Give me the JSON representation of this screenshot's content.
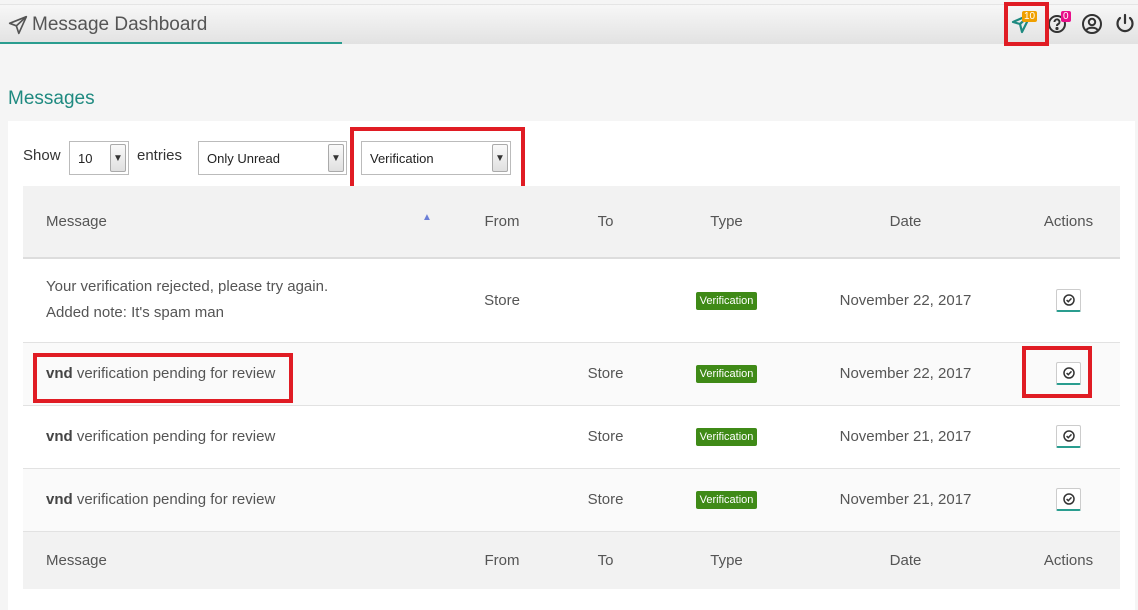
{
  "header": {
    "title": "Message Dashboard",
    "notifications_count": "10",
    "help_count": "0"
  },
  "section_title": "Messages",
  "controls": {
    "show_label": "Show",
    "entries_value": "10",
    "entries_label": "entries",
    "filter_read": "Only Unread",
    "filter_type": "Verification"
  },
  "table": {
    "columns": [
      "Message",
      "From",
      "To",
      "Type",
      "Date",
      "Actions"
    ],
    "rows": [
      {
        "line1": "Your verification rejected, please try again.",
        "line2": "Added note: It's spam man",
        "bold": "",
        "from": "Store",
        "to": "",
        "type": "Verification",
        "date": "November 22, 2017"
      },
      {
        "bold": "vnd",
        "line1": " verification pending for review",
        "line2": "",
        "from": "",
        "to": "Store",
        "type": "Verification",
        "date": "November 22, 2017"
      },
      {
        "bold": "vnd",
        "line1": " verification pending for review",
        "line2": "",
        "from": "",
        "to": "Store",
        "type": "Verification",
        "date": "November 21, 2017"
      },
      {
        "bold": "vnd",
        "line1": " verification pending for review",
        "line2": "",
        "from": "",
        "to": "Store",
        "type": "Verification",
        "date": "November 21, 2017"
      }
    ]
  },
  "colors": {
    "accent": "#1f8a80",
    "badge_green": "#3f8a17",
    "highlight_red": "#e01c24",
    "notif_orange": "#f0a000",
    "help_pink": "#e8108a"
  },
  "icons": [
    "paper-plane-icon",
    "help-icon",
    "user-icon",
    "power-icon",
    "check-circle-icon"
  ]
}
